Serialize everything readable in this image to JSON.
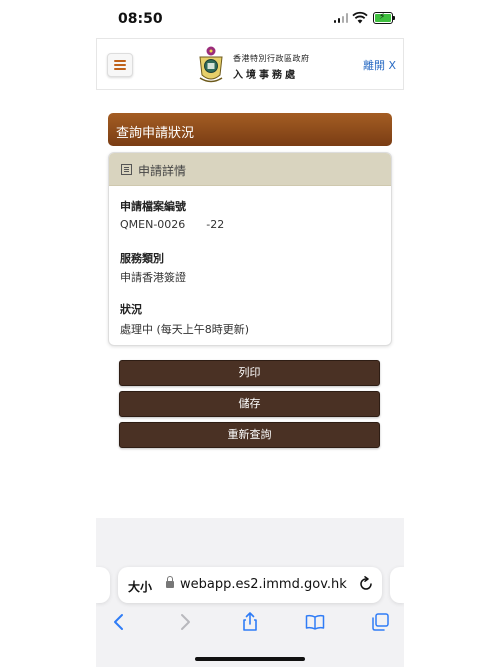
{
  "status_bar": {
    "time": "08:50"
  },
  "header": {
    "org_line1": "香港特別行政區政府",
    "org_line2": "入境事務處",
    "leave_label": "離開 X"
  },
  "page": {
    "title": "查詢申請狀況",
    "details_heading": "申請詳情",
    "fields": [
      {
        "label": "申請檔案編號",
        "value": "QMEN-0026      -22"
      },
      {
        "label": "服務類別",
        "value": "申請香港簽證"
      },
      {
        "label": "狀況",
        "value": "處理中 (每天上午8時更新)"
      }
    ]
  },
  "buttons": {
    "print": "列印",
    "save": "儲存",
    "re_enquire": "重新查詢"
  },
  "browser": {
    "text_size_label": "大小",
    "url": "webapp.es2.immd.gov.hk"
  },
  "colors": {
    "title_gradient_top": "#a45d23",
    "title_gradient_bottom": "#7a3d14",
    "card_header": "#d9d4bf",
    "button_bg": "#4a3124",
    "link_blue": "#2b6cc4",
    "safari_blue": "#2f7cf6"
  }
}
